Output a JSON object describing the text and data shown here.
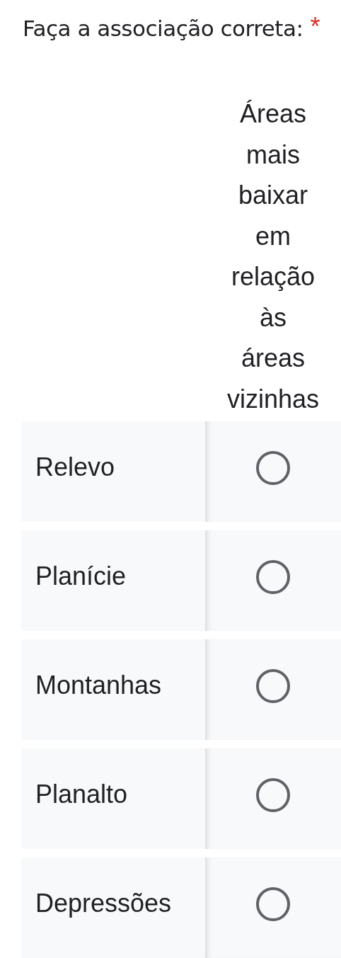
{
  "question": {
    "title": "Faça a associação correta:",
    "required_mark": "*"
  },
  "grid": {
    "columns": [
      "Áreas mais baixar em relação às áreas vizinhas"
    ],
    "rows": [
      {
        "label": "Relevo",
        "selected": false
      },
      {
        "label": "Planície",
        "selected": false
      },
      {
        "label": "Montanhas",
        "selected": false
      },
      {
        "label": "Planalto",
        "selected": false
      },
      {
        "label": "Depressões",
        "selected": false
      }
    ]
  }
}
